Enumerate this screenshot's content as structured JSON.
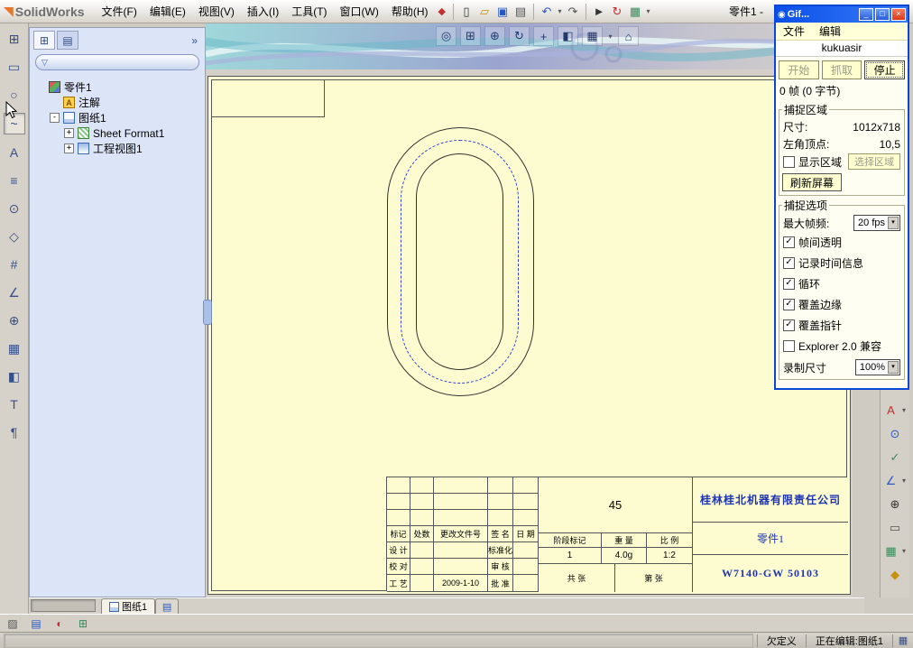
{
  "app": {
    "title": "SolidWorks",
    "doc_title": "零件1 -",
    "menus": [
      "文件(F)",
      "编辑(E)",
      "视图(V)",
      "插入(I)",
      "工具(T)",
      "窗口(W)",
      "帮助(H)"
    ]
  },
  "ui": {
    "dropdown_glyph": "▾",
    "panel_chevron": "»",
    "logo_glyph": "◥",
    "brand_mark": "◆",
    "filter_glyph": "▽",
    "status_icon": "▦",
    "tab_stub_glyph": "▤"
  },
  "main_toolbar": {
    "icons": [
      {
        "name": "new-document-icon",
        "glyph": "▯"
      },
      {
        "name": "open-icon",
        "glyph": "▱"
      },
      {
        "name": "save-icon",
        "glyph": "▣"
      },
      {
        "name": "print-icon",
        "glyph": "▤"
      },
      {
        "name": "undo-icon",
        "glyph": "↶"
      },
      {
        "name": "redo-icon",
        "glyph": "↷"
      },
      {
        "name": "select-icon",
        "glyph": "►"
      },
      {
        "name": "rebuild-icon",
        "glyph": "↻"
      },
      {
        "name": "options-icon",
        "glyph": "▦"
      }
    ]
  },
  "view_toolbar": {
    "icons": [
      {
        "name": "zoom-fit-icon",
        "glyph": "◎"
      },
      {
        "name": "zoom-area-icon",
        "glyph": "⊞"
      },
      {
        "name": "zoom-in-out-icon",
        "glyph": "⊕"
      },
      {
        "name": "rotate-view-icon",
        "glyph": "↻"
      },
      {
        "name": "pan-icon",
        "glyph": "+"
      },
      {
        "name": "section-view-icon",
        "glyph": "◧"
      },
      {
        "name": "display-style-icon",
        "glyph": "▦"
      },
      {
        "name": "view-orientation-icon",
        "glyph": "⌂"
      }
    ]
  },
  "left_toolbar": {
    "icons": [
      {
        "name": "view-palette-icon",
        "glyph": "⊞"
      },
      {
        "name": "rectangle-tool-icon",
        "glyph": "▭"
      },
      {
        "name": "circle-tool-icon",
        "glyph": "○"
      },
      {
        "name": "spline-tool-icon",
        "glyph": "~"
      },
      {
        "name": "text-tool-icon",
        "glyph": "A"
      },
      {
        "name": "centerline-tool-icon",
        "glyph": "≡"
      },
      {
        "name": "point-tool-icon",
        "glyph": "⊙"
      },
      {
        "name": "polygon-tool-icon",
        "glyph": "◇"
      },
      {
        "name": "hatch-tool-icon",
        "glyph": "#"
      },
      {
        "name": "dimension-tool-icon",
        "glyph": "∠"
      },
      {
        "name": "center-mark-tool-icon",
        "glyph": "⊕"
      },
      {
        "name": "table-tool-icon",
        "glyph": "▦"
      },
      {
        "name": "section-tool-icon",
        "glyph": "◧"
      },
      {
        "name": "trim-tool-icon",
        "glyph": "T"
      },
      {
        "name": "note-tool-icon",
        "glyph": "¶"
      }
    ]
  },
  "right_toolbar": {
    "icons": [
      {
        "name": "note-icon",
        "glyph": "A"
      },
      {
        "name": "balloon-icon",
        "glyph": "⊙"
      },
      {
        "name": "surface-finish-icon",
        "glyph": "✓"
      },
      {
        "name": "weld-symbol-icon",
        "glyph": "∠"
      },
      {
        "name": "geometric-tolerance-icon",
        "glyph": "⊕"
      },
      {
        "name": "datum-feature-icon",
        "glyph": "▭"
      },
      {
        "name": "table-icon",
        "glyph": "▦"
      },
      {
        "name": "block-icon",
        "glyph": "◆"
      }
    ]
  },
  "bottom_toolbar": {
    "icons": [
      {
        "name": "sketch-icon",
        "glyph": "▨"
      },
      {
        "name": "layer-icon",
        "glyph": "▤"
      },
      {
        "name": "color-icon",
        "glyph": "◐"
      },
      {
        "name": "grid-icon",
        "glyph": "⊞"
      }
    ]
  },
  "left_panel": {
    "tabs": [
      {
        "name": "feature-tree-tab",
        "glyph": "⊞"
      },
      {
        "name": "property-manager-tab",
        "glyph": "▤"
      }
    ],
    "filter_value": "",
    "tree": [
      {
        "label": "零件1",
        "expander": "",
        "glyph": ""
      },
      {
        "label": "注解",
        "expander": "",
        "glyph": "A"
      },
      {
        "label": "图纸1",
        "expander": "-",
        "glyph": ""
      },
      {
        "label": "Sheet Format1",
        "expander": "+",
        "glyph": ""
      },
      {
        "label": "工程视图1",
        "expander": "+",
        "glyph": ""
      }
    ]
  },
  "sheet": {
    "title_block": {
      "material": "45",
      "company": "桂林桂北机器有限责任公司",
      "part_name": "零件1",
      "drawing_number": "W7140-GW 50103",
      "rev": {
        "mark": "标记",
        "count": "处数",
        "doc_no": "更改文件号",
        "sign": "签 名",
        "date": "日 期"
      },
      "roles": {
        "design": "设 计",
        "standardize": "标准化",
        "check": "校 对",
        "audit": "审 核",
        "process": "工 艺",
        "approve": "批 准"
      },
      "stage_label": "阶段标记",
      "weight_label": "重 量",
      "scale_label": "比 例",
      "stage_value": "1",
      "weight_value": "4.0g",
      "scale_value": "1:2",
      "sheets_total": "共 张",
      "sheet_no": "第 张",
      "date_value": "2009-1-10"
    }
  },
  "tabs": {
    "sheet1": "图纸1"
  },
  "status": {
    "pane1": "欠定义",
    "pane2": "正在编辑:图纸1"
  },
  "gif_tool": {
    "title": "Gif...",
    "window_icon_glyph": "◉",
    "window_buttons": {
      "min": "_",
      "max": "□",
      "close": "×"
    },
    "menus": [
      "文件",
      "编辑"
    ],
    "filename": "kukuasir",
    "buttons": {
      "start": "开始",
      "grab": "抓取",
      "stop": "停止"
    },
    "frames_status": "0 帧 (0 字节)",
    "capture_area": {
      "legend": "捕捉区域",
      "size_label": "尺寸:",
      "size_value": "1012x718",
      "corner_label": "左角顶点:",
      "corner_value": "10,5",
      "show_area_label": "显示区域",
      "show_area_mark": "",
      "select_area_label": "选择区域",
      "refresh_label": "刷新屏幕"
    },
    "capture_options": {
      "legend": "捕捉选项",
      "fps_label": "最大帧频:",
      "fps_value": "20 fps",
      "record_label": "录制尺寸",
      "record_value": "100%",
      "checkboxes": [
        {
          "label": "帧间透明",
          "mark": "✓"
        },
        {
          "label": "记录时间信息",
          "mark": "✓"
        },
        {
          "label": "循环",
          "mark": "✓"
        },
        {
          "label": "覆盖边缘",
          "mark": "✓"
        },
        {
          "label": "覆盖指针",
          "mark": "✓"
        },
        {
          "label": "Explorer 2.0 兼容",
          "mark": ""
        }
      ]
    }
  }
}
